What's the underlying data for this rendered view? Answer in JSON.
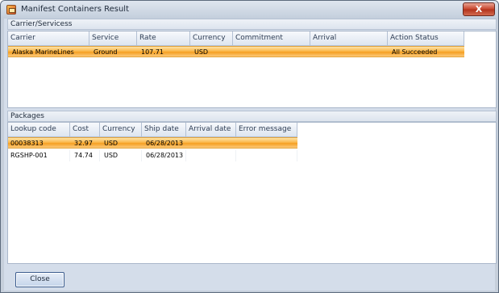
{
  "window": {
    "title": "Manifest Containers Result",
    "close_glyph": "X"
  },
  "carrier_group": {
    "title": "Carrier/Servicess",
    "columns": [
      "Carrier",
      "Service",
      "Rate",
      "Currency",
      "Commitment",
      "Arrival",
      "Action Status"
    ],
    "rows": [
      [
        "Alaska MarineLines",
        "Ground",
        "107.71",
        "USD",
        "",
        "",
        "All Succeeded"
      ]
    ]
  },
  "packages_group": {
    "title": "Packages",
    "columns": [
      "Lookup code",
      "Cost",
      "Currency",
      "Ship date",
      "Arrival date",
      "Error message"
    ],
    "rows": [
      [
        "00038313",
        "32.97",
        "USD",
        "06/28/2013",
        "",
        ""
      ],
      [
        "RGSHP-001",
        "74.74",
        "USD",
        "06/28/2013",
        "",
        ""
      ]
    ]
  },
  "footer": {
    "close_label": "Close"
  },
  "colors": {
    "selection": "#f5a52a",
    "header_bg": "#dde5f0",
    "window_bg": "#d4ddea"
  },
  "icons": {
    "app": "manifest-app-icon",
    "close": "close-icon"
  }
}
